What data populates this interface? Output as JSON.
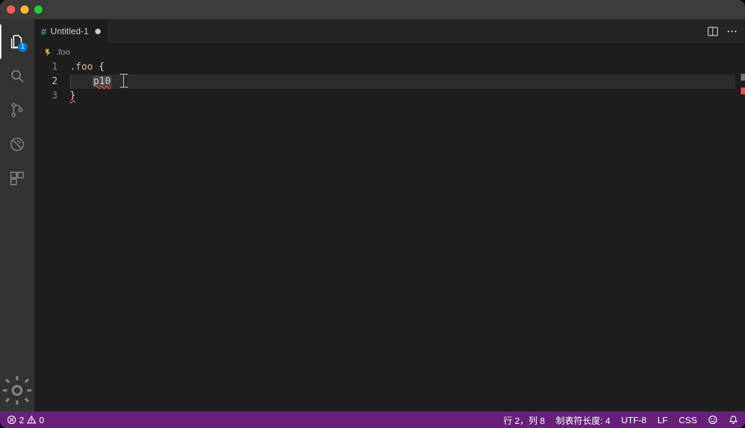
{
  "tab": {
    "filename": "Untitled-1",
    "dirty": true
  },
  "breadcrumbs": {
    "item": ".foo"
  },
  "editor": {
    "lines": {
      "l1_selector": ".foo",
      "l1_brace": " {",
      "l2_text": "p10",
      "l3_text": "}"
    },
    "line_numbers": {
      "n1": "1",
      "n2": "2",
      "n3": "3"
    }
  },
  "activity": {
    "explorer_badge": "1"
  },
  "status": {
    "errors": "2",
    "warnings": "0",
    "cursor_pos": "行 2，列 8",
    "tab_size": "制表符长度: 4",
    "encoding": "UTF-8",
    "eol": "LF",
    "language": "CSS"
  }
}
